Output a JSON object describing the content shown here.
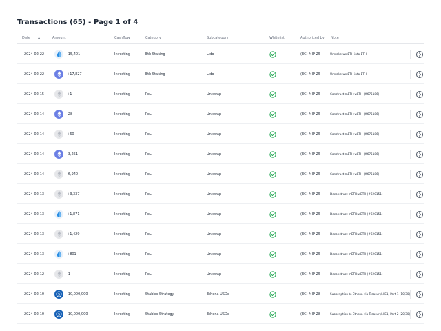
{
  "page": {
    "title": "Transactions (65) - Page 1 of 4"
  },
  "columns": {
    "date": "Date",
    "amount": "Amount",
    "cashflow": "Cashflow",
    "category": "Category",
    "subcategory": "Subcategory",
    "whitelist": "Whitelist",
    "authorized_by": "Authorized by",
    "note": "Note"
  },
  "sort": {
    "column": "date",
    "direction": "ascending-indicator"
  },
  "colors": {
    "check": "#16a34a",
    "eth": "#6b7fe5",
    "drop": "#2a8ee3",
    "usde": "#1560b6"
  },
  "rows": [
    {
      "date": "2024-02-22",
      "icon": "ldo-drop-icon",
      "amount": "-15,401",
      "cashflow": "Investing",
      "category": "Eth Staking",
      "subcategory": "Lido",
      "whitelisted": true,
      "authorized_by": "(EC) MIP-25",
      "note": "Unstake wstETH into ETH"
    },
    {
      "date": "2024-02-22",
      "icon": "eth-icon",
      "amount": "+17,827",
      "cashflow": "Investing",
      "category": "Eth Staking",
      "subcategory": "Lido",
      "whitelisted": true,
      "authorized_by": "(EC) MIP-25",
      "note": "Unstake wstETH into ETH"
    },
    {
      "date": "2024-02-15",
      "icon": "eth-grey-icon",
      "amount": "+1",
      "cashflow": "Investing",
      "category": "PoL",
      "subcategory": "Uniswap",
      "whitelisted": true,
      "authorized_by": "(EC) MIP-25",
      "note": "Construct mETH:wETH (#675186)"
    },
    {
      "date": "2024-02-14",
      "icon": "eth-icon",
      "amount": "-28",
      "cashflow": "Investing",
      "category": "PoL",
      "subcategory": "Uniswap",
      "whitelisted": true,
      "authorized_by": "(EC) MIP-25",
      "note": "Construct mETH:wETH (#675186)"
    },
    {
      "date": "2024-02-14",
      "icon": "eth-grey-icon",
      "amount": "+60",
      "cashflow": "Investing",
      "category": "PoL",
      "subcategory": "Uniswap",
      "whitelisted": true,
      "authorized_by": "(EC) MIP-25",
      "note": "Construct mETH:wETH (#675186)"
    },
    {
      "date": "2024-02-14",
      "icon": "eth-icon",
      "amount": "-3,251",
      "cashflow": "Investing",
      "category": "PoL",
      "subcategory": "Uniswap",
      "whitelisted": true,
      "authorized_by": "(EC) MIP-25",
      "note": "Construct mETH:wETH (#675186)"
    },
    {
      "date": "2024-02-14",
      "icon": "eth-grey-icon",
      "amount": "-6,940",
      "cashflow": "Investing",
      "category": "PoL",
      "subcategory": "Uniswap",
      "whitelisted": true,
      "authorized_by": "(EC) MIP-25",
      "note": "Construct mETH:wETH (#675186)"
    },
    {
      "date": "2024-02-13",
      "icon": "eth-grey-icon",
      "amount": "+3,337",
      "cashflow": "Investing",
      "category": "PoL",
      "subcategory": "Uniswap",
      "whitelisted": true,
      "authorized_by": "(EC) MIP-25",
      "note": "Deconstruct mETH:wETH (#620151)"
    },
    {
      "date": "2024-02-13",
      "icon": "ldo-drop-icon",
      "amount": "+1,871",
      "cashflow": "Investing",
      "category": "PoL",
      "subcategory": "Uniswap",
      "whitelisted": true,
      "authorized_by": "(EC) MIP-25",
      "note": "Deconstruct mETH:wETH (#620151)"
    },
    {
      "date": "2024-02-13",
      "icon": "eth-grey-icon",
      "amount": "+1,429",
      "cashflow": "Investing",
      "category": "PoL",
      "subcategory": "Uniswap",
      "whitelisted": true,
      "authorized_by": "(EC) MIP-25",
      "note": "Deconstruct mETH:wETH (#620151)"
    },
    {
      "date": "2024-02-13",
      "icon": "ldo-drop-icon",
      "amount": "+801",
      "cashflow": "Investing",
      "category": "PoL",
      "subcategory": "Uniswap",
      "whitelisted": true,
      "authorized_by": "(EC) MIP-25",
      "note": "Deconstruct mETH:wETH (#620151)"
    },
    {
      "date": "2024-02-12",
      "icon": "eth-grey-icon",
      "amount": "-1",
      "cashflow": "Investing",
      "category": "PoL",
      "subcategory": "Uniswap",
      "whitelisted": true,
      "authorized_by": "(EC) MIP-25",
      "note": "Deconstruct mETH:wETH (#620151)"
    },
    {
      "date": "2024-02-10",
      "icon": "usde-icon",
      "amount": "-10,000,000",
      "cashflow": "Investing",
      "category": "Stables Strategy",
      "subcategory": "Ethena USDe",
      "whitelisted": true,
      "authorized_by": "(EC) MIP-28",
      "note": "Subscription to Ethena via TreasuryLl-E1, Part 1 (10/30)"
    },
    {
      "date": "2024-02-10",
      "icon": "usde-icon",
      "amount": "-10,000,000",
      "cashflow": "Investing",
      "category": "Stables Strategy",
      "subcategory": "Ethena USDe",
      "whitelisted": true,
      "authorized_by": "(EC) MIP-28",
      "note": "Subscription to Ethena via TreasuryLl-E1, Part 2 (20/30)"
    }
  ]
}
